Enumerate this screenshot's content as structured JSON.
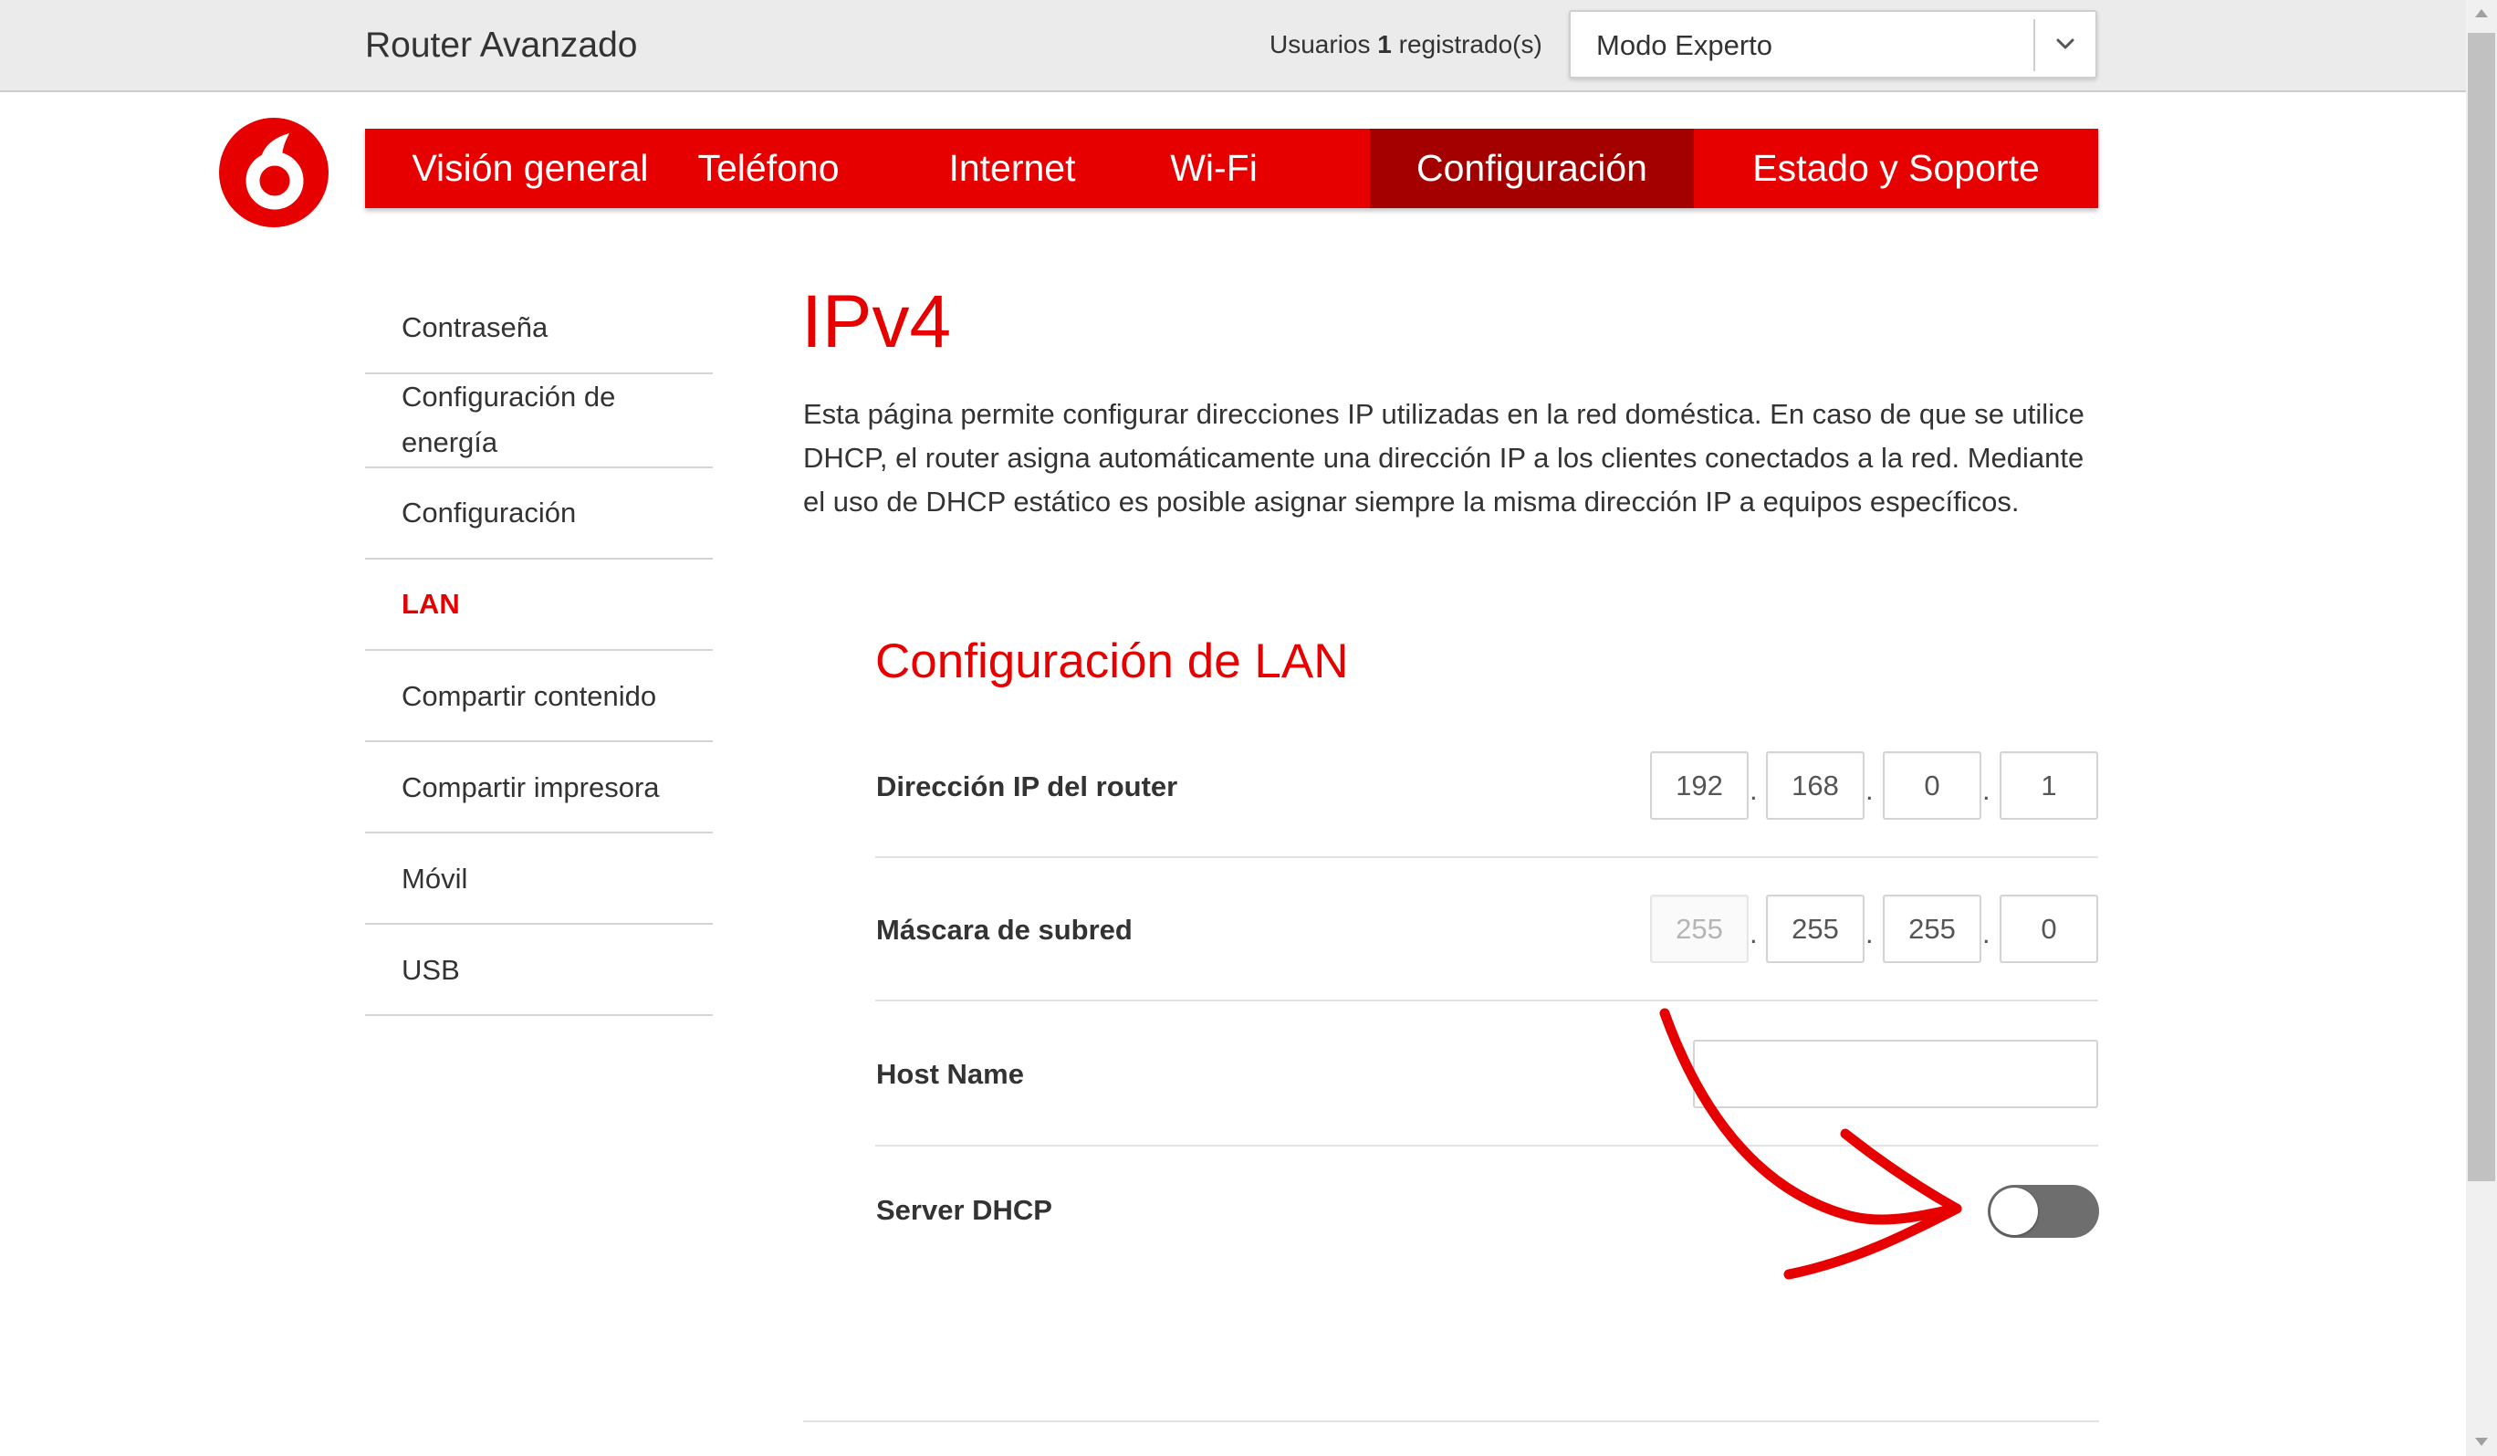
{
  "header": {
    "app_title": "Router Avanzado",
    "users_label": "Usuarios",
    "users_count": "1",
    "users_suffix": "registrado(s)",
    "mode_value": "Modo Experto"
  },
  "nav": {
    "items": [
      {
        "label": "Visión general"
      },
      {
        "label": "Teléfono"
      },
      {
        "label": "Internet"
      },
      {
        "label": "Wi-Fi"
      },
      {
        "label": "Configuración",
        "active": true
      },
      {
        "label": "Estado y Soporte"
      }
    ]
  },
  "sidebar": {
    "items": [
      {
        "label": "Contraseña"
      },
      {
        "label": "Configuración de energía"
      },
      {
        "label": "Configuración"
      },
      {
        "label": "LAN",
        "active": true
      },
      {
        "label": "Compartir contenido"
      },
      {
        "label": "Compartir impresora"
      },
      {
        "label": "Móvil"
      },
      {
        "label": "USB"
      }
    ]
  },
  "main": {
    "title": "IPv4",
    "intro": "Esta página permite configurar direcciones IP utilizadas en la red doméstica. En caso de que se utilice DHCP, el router asigna automáticamente una dirección IP a los clientes conectados a la red. Mediante el uso de DHCP estático es posible asignar siempre la misma dirección IP a equipos específicos.",
    "section_title": "Configuración de LAN",
    "router_ip": {
      "label": "Dirección IP del router",
      "octets": [
        "192",
        "168",
        "0",
        "1"
      ]
    },
    "subnet_mask": {
      "label": "Máscara de subred",
      "octets": [
        "255",
        "255",
        "255",
        "0"
      ]
    },
    "host_name": {
      "label": "Host Name",
      "value": ""
    },
    "dhcp_server": {
      "label": "Server DHCP",
      "enabled": false
    }
  },
  "colors": {
    "brand_red": "#e60000",
    "active_nav": "#a50000",
    "toggle_off": "#6e6e6e"
  }
}
